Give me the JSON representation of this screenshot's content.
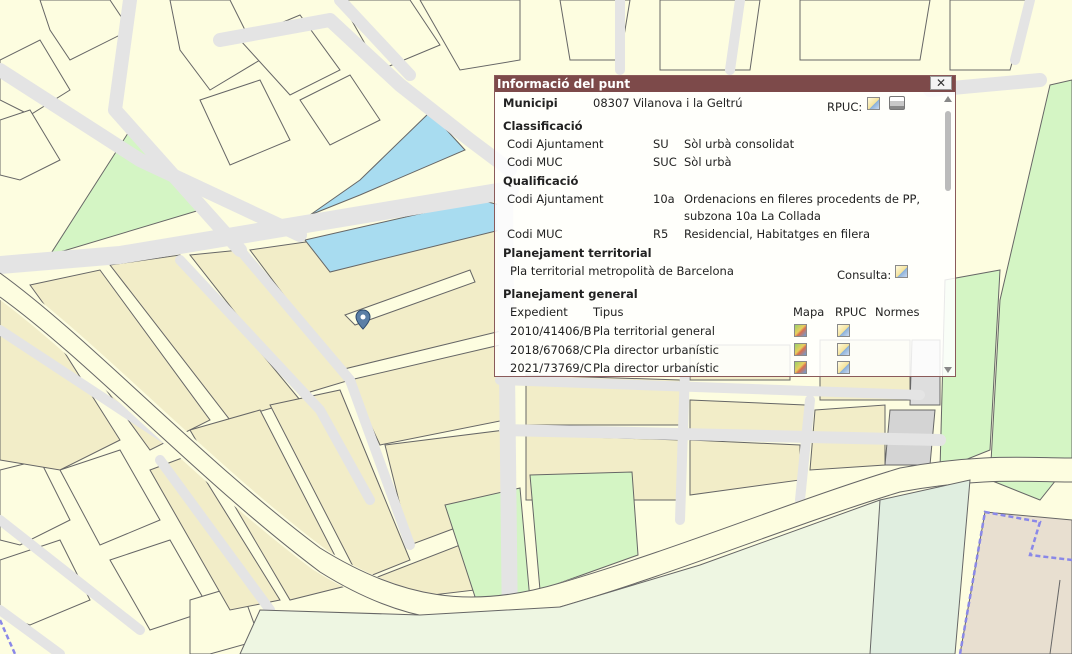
{
  "popup": {
    "title": "Informació del punt",
    "close_label": "✕",
    "municipi_label": "Municipi",
    "municipi_value": "08307 Vilanova i la Geltrú",
    "rpuc_label": "RPUC:",
    "classificacio": {
      "heading": "Classificació",
      "rows": [
        {
          "label": "Codi Ajuntament",
          "code": "SU",
          "desc": "Sòl urbà consolidat"
        },
        {
          "label": "Codi MUC",
          "code": "SUC",
          "desc": "Sòl urbà"
        }
      ]
    },
    "qualificacio": {
      "heading": "Qualificació",
      "rows": [
        {
          "label": "Codi Ajuntament",
          "code": "10a",
          "desc": "Ordenacions en fileres procedents de PP,",
          "desc2": "subzona 10a La Collada"
        },
        {
          "label": "Codi MUC",
          "code": "R5",
          "desc": "Residencial, Habitatges en filera"
        }
      ]
    },
    "territorial": {
      "heading": "Planejament territorial",
      "plan": "Pla territorial metropolità de Barcelona",
      "consulta_label": "Consulta:"
    },
    "general": {
      "heading": "Planejament general",
      "headers": {
        "expedient": "Expedient",
        "tipus": "Tipus",
        "mapa": "Mapa",
        "rpuc": "RPUC",
        "normes": "Normes"
      },
      "rows": [
        {
          "expedient": "2010/41406/B",
          "tipus": "Pla territorial general"
        },
        {
          "expedient": "2018/67068/C",
          "tipus": "Pla director urbanístic"
        },
        {
          "expedient": "2021/73769/C",
          "tipus": "Pla director urbanístic"
        }
      ]
    }
  },
  "icons": {
    "marker": "location-pin-icon",
    "doc": "document-icon",
    "map": "map-icon",
    "print": "printer-icon"
  },
  "colors": {
    "title_bar": "#7d4a4a",
    "urban_block": "#f2edc8",
    "green_zone": "#d4f5c4",
    "water": "#a8dcf0",
    "road": "#e4e4e4",
    "background": "#fdfde0"
  }
}
